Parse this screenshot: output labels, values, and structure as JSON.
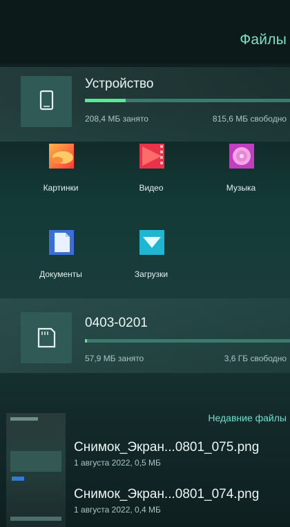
{
  "header": {
    "title": "Файлы"
  },
  "device": {
    "name": "Устройство",
    "used": "208,4 МБ занято",
    "free": "815,6 МБ свободно",
    "used_fraction": 0.2
  },
  "categories": [
    {
      "label": "Картинки",
      "icon": "pictures-icon"
    },
    {
      "label": "Видео",
      "icon": "video-icon"
    },
    {
      "label": "Музыка",
      "icon": "music-icon"
    },
    {
      "label": "Документы",
      "icon": "documents-icon"
    },
    {
      "label": "Загрузки",
      "icon": "downloads-icon"
    }
  ],
  "sdcard": {
    "name": "0403-0201",
    "used": "57,9 МБ занято",
    "free": "3,6 ГБ свободно",
    "used_fraction": 0.01
  },
  "recent": {
    "link_label": "Недавние файлы",
    "files": [
      {
        "name": "Снимок_Экран...0801_075.png",
        "meta": "1 августа 2022, 0,5 МБ"
      },
      {
        "name": "Снимок_Экран...0801_074.png",
        "meta": "1 августа 2022, 0,4 МБ"
      }
    ]
  },
  "colors": {
    "accent": "#57e89a",
    "link": "#6fe0cc"
  }
}
